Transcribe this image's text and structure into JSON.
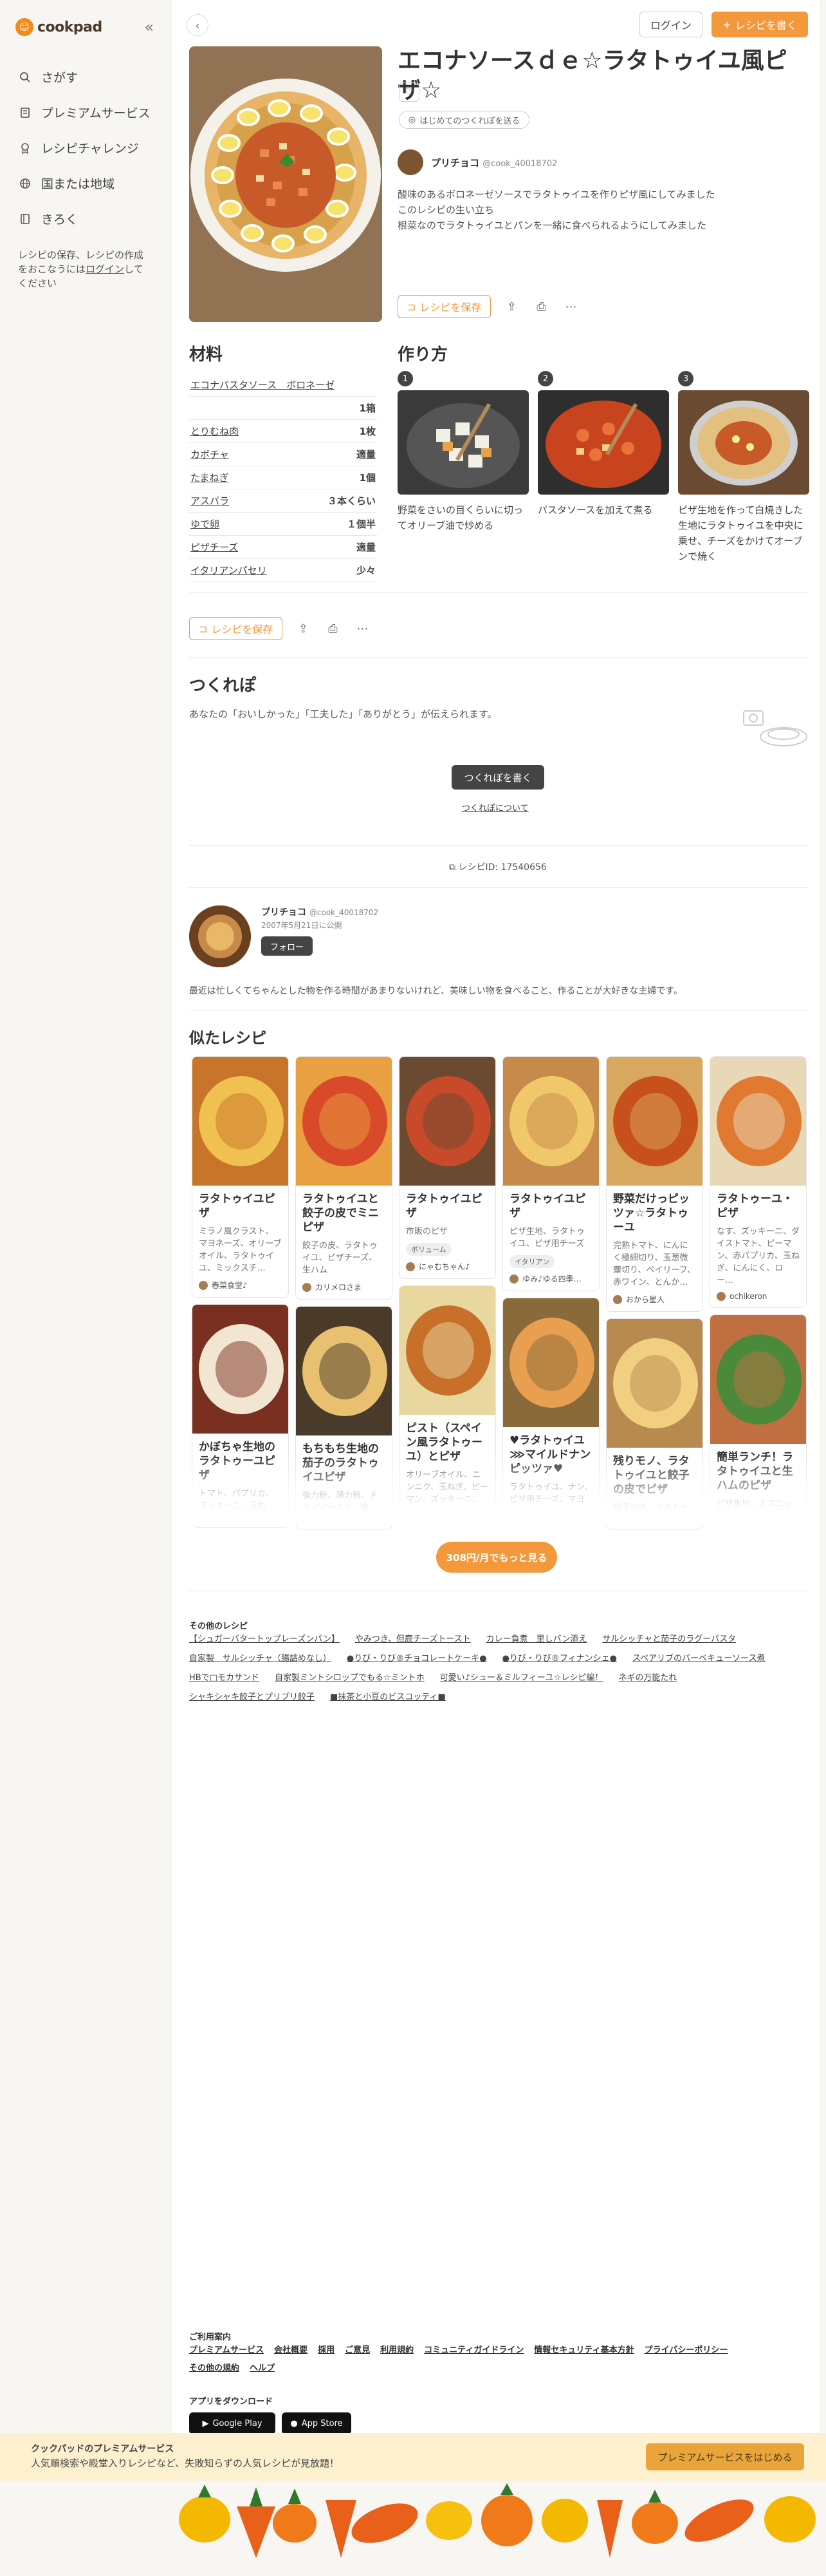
{
  "brand": {
    "name": "cookpad",
    "accent": "#f3983b"
  },
  "sidebar": {
    "collapse_icon": "«",
    "items": [
      {
        "label": "さがす",
        "icon": "search-icon"
      },
      {
        "label": "プレミアムサービス",
        "icon": "premium-icon"
      },
      {
        "label": "レシピチャレンジ",
        "icon": "challenge-icon"
      },
      {
        "label": "国または地域",
        "icon": "globe-icon"
      },
      {
        "label": "きろく",
        "icon": "record-icon"
      }
    ],
    "note_pre": "レシピの保存、レシピの作成をおこなうには",
    "note_link": "ログイン",
    "note_post": "してください"
  },
  "header": {
    "back": "‹",
    "login": "ログイン",
    "write_recipe": "レシピを書く",
    "write_plus": "+"
  },
  "recipe": {
    "title": "エコナソースｄｅ☆ラタトゥイユ風ピザ☆",
    "first_tsukurepo": "はじめてのつくれぽを送る",
    "author_name": "プリチョコ",
    "author_id": "@cook_40018702",
    "description": "酸味のあるボロネーゼソースでラタトゥイユを作りピザ風にしてみました\nこのレシピの生い立ち\n根菜なのでラタトゥイユとパンを一緒に食べられるようにしてみました",
    "save": "レシピを保存",
    "id_label": "レシピID: 17540656"
  },
  "ingredients": {
    "title": "材料",
    "items": [
      {
        "name": "エコナパスタソース　ボロネーゼ",
        "amount": ""
      },
      {
        "name": "",
        "amount": "1箱"
      },
      {
        "name": "とりむね肉",
        "amount": "1枚"
      },
      {
        "name": "カボチャ",
        "amount": "適量"
      },
      {
        "name": "たまねぎ",
        "amount": "1個"
      },
      {
        "name": "アスパラ",
        "amount": "３本くらい"
      },
      {
        "name": "ゆで卵",
        "amount": "１個半"
      },
      {
        "name": "ピザチーズ",
        "amount": "適量"
      },
      {
        "name": "イタリアンパセリ",
        "amount": "少々"
      }
    ]
  },
  "steps": {
    "title": "作り方",
    "items": [
      {
        "num": "1",
        "text": "野菜をさいの目くらいに切ってオリーブ油で炒める"
      },
      {
        "num": "2",
        "text": "パスタソースを加えて煮る"
      },
      {
        "num": "3",
        "text": "ピザ生地を作って白焼きした生地にラタトゥイユを中央に乗せ、チーズをかけてオーブンで焼く"
      }
    ]
  },
  "tsukurepo": {
    "title": "つくれぽ",
    "intro": "あなたの「おいしかった」「工夫した」「ありがとう」が伝えられます。",
    "write": "つくれぽを書く",
    "about": "つくれぽについて"
  },
  "author_profile": {
    "name": "プリチョコ",
    "id": "@cook_40018702",
    "since": "2007年5月21日に公開",
    "follow": "フォロー",
    "bio": "最近は忙しくてちゃんとした物を作る時間があまりないけれど、美味しい物を食べること、作ることが大好きな主婦です。"
  },
  "similar": {
    "title": "似たレシピ",
    "columns": [
      [
        {
          "title": "ラタトゥイユピザ",
          "ingredients": "ミラノ風クラスト、マヨネーズ、オリーブオイル、ラタトゥイユ、ミックスチ…",
          "author": "春菜食堂♪",
          "img": "pizza1"
        },
        {
          "title": "かぼちゃ生地のラタトゥーユピザ",
          "ingredients": "トマト、パプリカ、ズッキーニ、玉ねぎ、ナ",
          "author": "",
          "img": "pizza2"
        }
      ],
      [
        {
          "title": "ラタトゥイユと餃子の皮でミニピザ",
          "ingredients": "餃子の皮、ラタトゥイユ、ピザチーズ、生ハム",
          "author": "カリメロさま",
          "img": "pizza3"
        },
        {
          "title": "もちもち生地の茄子のラタトゥイユピザ",
          "ingredients": "強力粉、薄力粉、ドライイースト、塩、砂",
          "author": "",
          "img": "pizza4"
        }
      ],
      [
        {
          "title": "ラタトゥイユピザ",
          "ingredients": "市販のピザ",
          "badge": "ボリューム",
          "author": "にゃむちゃん♪",
          "img": "pizza5"
        },
        {
          "title": "ピスト（スペイン風ラタトゥーユ）とピザ",
          "ingredients": "オリーブオイル、ニンニク、玉ねぎ、ピーマン、ズッキーニ、ナ",
          "author": "",
          "img": "pizza6"
        }
      ],
      [
        {
          "title": "ラタトゥイユピザ",
          "ingredients": "ピザ生地、ラタトゥイユ、ピザ用チーズ",
          "badge": "イタリアン",
          "author": "ゆみ♪ゆる四季…",
          "img": "pizza7"
        },
        {
          "title": "♥ラタトゥイユ⋙マイルドナンピッツァ♥",
          "ingredients": "ラタトゥイユ、ナン、ピザ用チーズ、マヨ",
          "author": "",
          "img": "pizza8"
        }
      ],
      [
        {
          "title": "野菜だけっピッツァ☆ラタトゥーユ",
          "ingredients": "完熟トマト、にんにく極細切り、玉葱微塵切り、ベイリーフ、赤ワイン、とんか…",
          "author": "おから星人",
          "img": "pizza9"
        },
        {
          "title": "残りモノ、ラタトゥイユと餃子の皮でピザ",
          "ingredients": "餃子の皮、ラタトゥイユ",
          "author": "",
          "img": "pizza10"
        }
      ],
      [
        {
          "title": "ラタトゥーユ・ピザ",
          "ingredients": "なす、ズッキーニ、ダイストマト、ピーマン、赤パプリカ、玉ねぎ、にんにく、ロー…",
          "author": "ochikeron",
          "img": "pizza11"
        },
        {
          "title": "簡単ランチ！ラタトゥイユと生ハムのピザ",
          "ingredients": "ピザ生地、エスニックトマトソース、ラ",
          "author": "",
          "img": "pizza12"
        }
      ]
    ],
    "premium_more": "308円/月でもっと見る"
  },
  "other_recipes": {
    "title": "その他のレシピ",
    "links": [
      "【シュガーバタートップレーズンパン】",
      "やみつき、但鹿チーズトースト",
      "カレー負煮　里しバン添え",
      "サルシッチャと茄子のラグーパスタ",
      "自家製　サルシッチャ（腸詰めなし）",
      "●りび・りび®チョコレートケーキ●",
      "●りび・りび®フィナンシェ●",
      "スペアリブのバーベキューソース煮",
      "HBで□モカサンド",
      "自家製ミントシロップでもる☆ミントホ",
      "可愛い♪シュー＆ミルフィーユ☆レシピ編！",
      "ネギの万能たれ",
      "シャキシャキ餃子とプリプリ餃子",
      "■抹茶と小豆のビスコッティ■"
    ]
  },
  "footer": {
    "guide_title": "ご利用案内",
    "links": [
      "プレミアムサービス",
      "会社概要",
      "採用",
      "ご意見",
      "利用規約",
      "コミュニティガイドライン",
      "情報セキュリティ基本方針",
      "プライバシーポリシー",
      "その他の規約",
      "ヘルプ"
    ],
    "app_title": "アプリをダウンロード",
    "google_play": "Google Play",
    "app_store": "App Store"
  },
  "banner": {
    "line1": "クックパッドのプレミアムサービス",
    "line2": "人気順検索や殿堂入りレシピなど、失敗知らずの人気レシピが見放題！",
    "cta": "プレミアムサービスをはじめる"
  }
}
